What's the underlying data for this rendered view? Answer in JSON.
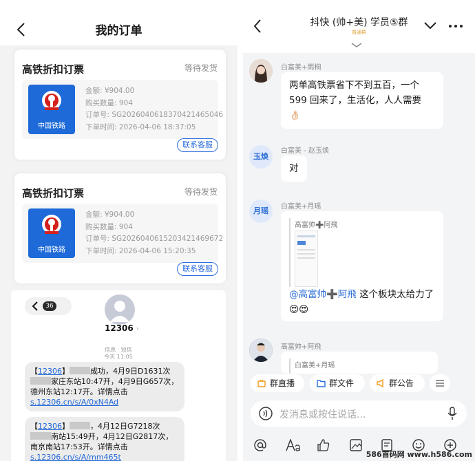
{
  "left": {
    "title": "我的订单",
    "orders": [
      {
        "title": "高铁折扣订票",
        "status": "等待发货",
        "logo_text": "中国铁路",
        "amount": "金额: ¥904.00",
        "quantity": "购买数量: 904",
        "order_no": "订单号: SG202604061837042146504б",
        "order_time": "下单时间: 2026-04-06 18:37:05",
        "service_btn": "联系客服"
      },
      {
        "title": "高铁折扣订票",
        "status": "等待发货",
        "logo_text": "中国铁路",
        "amount": "金额: ¥904.00",
        "quantity": "购买数量: 904",
        "order_no": "订单号: SG202604061520342146967‌2",
        "order_time": "下单时间: 2026-04-06 15:20:35",
        "service_btn": "联系客服"
      }
    ],
    "sms": {
      "back_count": "36",
      "sender": "12306",
      "meta_line1": "信息 · 短信",
      "meta_line2": "今天 11:05",
      "msg1": {
        "prefix": "【",
        "link1": "12306",
        "text1": "】",
        "text2": "成功，4月9日D1631次",
        "text3": "家庄东站10:47开，4月9日G657次，德州东站12:17开。详情点击",
        "link2": "s.12306.cn/s/A/0xN4Ad"
      },
      "msg2": {
        "prefix": "【",
        "link1": "12306",
        "text1": "】",
        "text2": "，4月12日G7218次",
        "text3": "南站15:49开，4月12日G2817次，南京南站17:53开。详情点击",
        "link2": "s.12306.cn/s/A/mm465t"
      }
    }
  },
  "right": {
    "title": "抖快 (帅+美) 学员⑤群",
    "subtitle": "普通群",
    "messages": [
      {
        "sender": "白富美+雨桐",
        "text": "两单高铁票省下不到五百，一个599 回来了，生活化，人人需要",
        "emoji": "👌🏻"
      },
      {
        "sender": "白富美 - 赵玉焕",
        "avatar_text": "玉焕",
        "text": "对"
      },
      {
        "sender": "白富美+月瑶",
        "avatar_text": "月瑶",
        "quote": "高富帅➕阿飛",
        "mention": "@高富帅➕阿飛",
        "text": " 这个板块太给力了",
        "emoji": "😍😍"
      },
      {
        "sender": "高富帅+阿飛",
        "quote": "白富美+月瑶"
      }
    ],
    "chips": [
      "群直播",
      "群文件",
      "群公告"
    ],
    "input_placeholder": "发消息或按住说话...",
    "watermark": "586首码网 www.h586.com"
  },
  "colors": {
    "accent": "#2d6fe0",
    "rail_blue": "#1e6ad8",
    "rail_red": "#d3211d"
  }
}
